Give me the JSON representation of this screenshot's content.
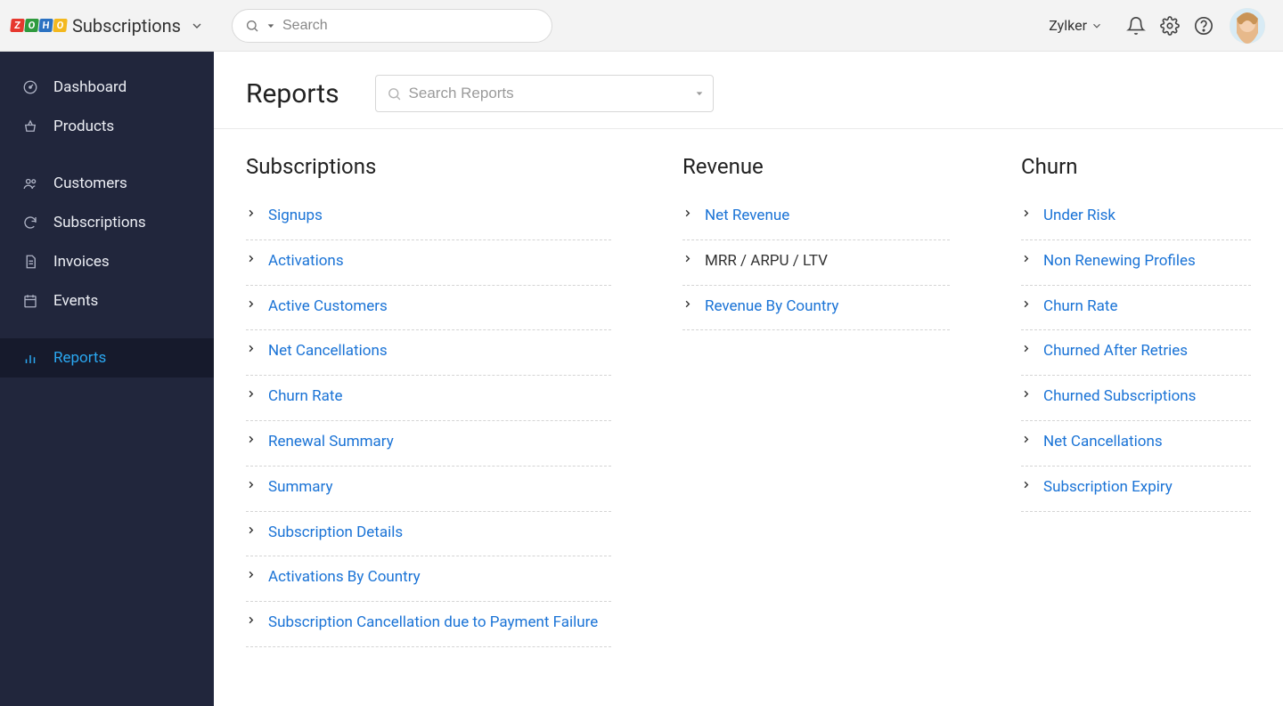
{
  "header": {
    "product_name": "Subscriptions",
    "search_placeholder": "Search",
    "company_name": "Zylker"
  },
  "sidebar": {
    "items": [
      {
        "id": "dashboard",
        "label": "Dashboard",
        "icon": "gauge-icon"
      },
      {
        "id": "products",
        "label": "Products",
        "icon": "basket-icon"
      },
      {
        "id": "customers",
        "label": "Customers",
        "icon": "users-icon"
      },
      {
        "id": "subscriptions",
        "label": "Subscriptions",
        "icon": "refresh-dollar-icon"
      },
      {
        "id": "invoices",
        "label": "Invoices",
        "icon": "document-icon"
      },
      {
        "id": "events",
        "label": "Events",
        "icon": "calendar-icon"
      },
      {
        "id": "reports",
        "label": "Reports",
        "icon": "bar-chart-icon",
        "active": true
      }
    ]
  },
  "main": {
    "title": "Reports",
    "search_placeholder": "Search Reports",
    "categories": [
      {
        "title": "Subscriptions",
        "items": [
          {
            "label": "Signups"
          },
          {
            "label": "Activations"
          },
          {
            "label": "Active Customers"
          },
          {
            "label": "Net Cancellations"
          },
          {
            "label": "Churn Rate"
          },
          {
            "label": "Renewal Summary"
          },
          {
            "label": "Summary"
          },
          {
            "label": "Subscription Details"
          },
          {
            "label": "Activations By Country"
          },
          {
            "label": "Subscription Cancellation due to Payment Failure"
          }
        ]
      },
      {
        "title": "Revenue",
        "items": [
          {
            "label": "Net Revenue"
          },
          {
            "label": "MRR / ARPU / LTV",
            "dark": true
          },
          {
            "label": "Revenue By Country"
          }
        ]
      },
      {
        "title": "Churn",
        "items": [
          {
            "label": "Under Risk"
          },
          {
            "label": "Non Renewing Profiles"
          },
          {
            "label": "Churn Rate"
          },
          {
            "label": "Churned After Retries"
          },
          {
            "label": "Churned Subscriptions"
          },
          {
            "label": "Net Cancellations"
          },
          {
            "label": "Subscription Expiry"
          }
        ]
      }
    ]
  }
}
